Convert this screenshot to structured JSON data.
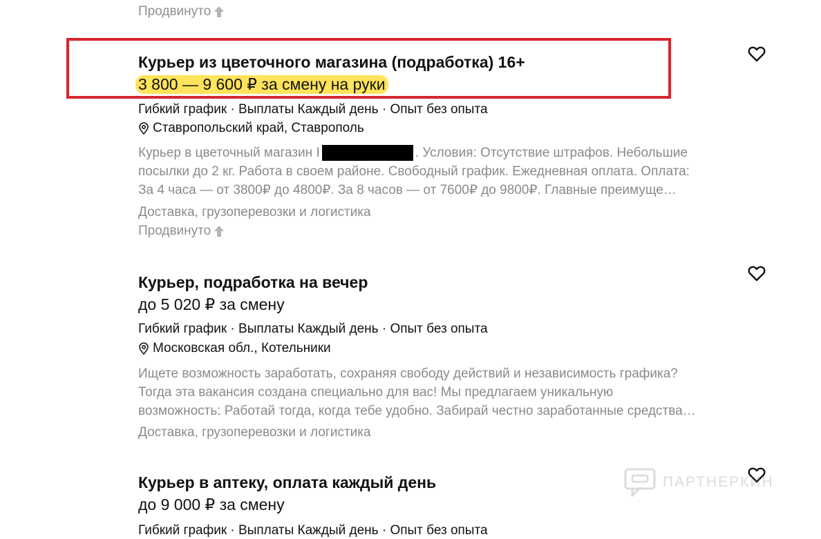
{
  "top_promoted": "Продвинуто",
  "listings": [
    {
      "title": "Курьер из цветочного магазина (подработка) 16+",
      "salary": "3 800 — 9 600 ₽ за смену на руки",
      "tags": "Гибкий график · Выплаты Каждый день · Опыт без опыта",
      "location": "Ставропольский край, Ставрополь",
      "desc_line1_before": "Курьер в цветочный магазин I",
      "desc_line1_after": ". Условия: Отсутствие штрафов. Небольшие",
      "desc_line2": "посылки до 2 кг. Работа в своем районе. Свободный график. Ежедневная оплата. Оплата:",
      "desc_line3": "За 4 часа — от 3800₽ до 4800₽. За 8 часов — от 7600₽ до 9800₽. Главные преимуще…",
      "category": "Доставка, грузоперевозки и логистика",
      "promoted": "Продвинуто"
    },
    {
      "title": "Курьер, подработка на вечер",
      "salary": "до 5 020 ₽ за смену",
      "tags": "Гибкий график · Выплаты Каждый день · Опыт без опыта",
      "location": "Московская обл., Котельники",
      "desc_line1": "Ищете возможность заработать, сохраняя свободу действий и независимость графика?",
      "desc_line2": "Тогда эта вакансия создана специально для вас! Мы предлагаем уникальную",
      "desc_line3": "возможность: Работай тогда, когда тебе удобно. Забирай честно заработанные средства…",
      "category": "Доставка, грузоперевозки и логистика"
    },
    {
      "title": "Курьер в аптеку, оплата каждый день",
      "salary": "до 9 000 ₽ за смену",
      "tags": "Гибкий график · Выплаты Каждый день · Опыт без опыта"
    }
  ],
  "watermark": "ПАРТНЕРКИН",
  "colors": {
    "highlight_border": "#d6262f",
    "salary_highlight": "#ffe35a",
    "muted_text": "#8a8a8a"
  },
  "icons": [
    "arrow-up-icon",
    "map-pin-icon",
    "heart-icon",
    "chat-logo-icon"
  ]
}
